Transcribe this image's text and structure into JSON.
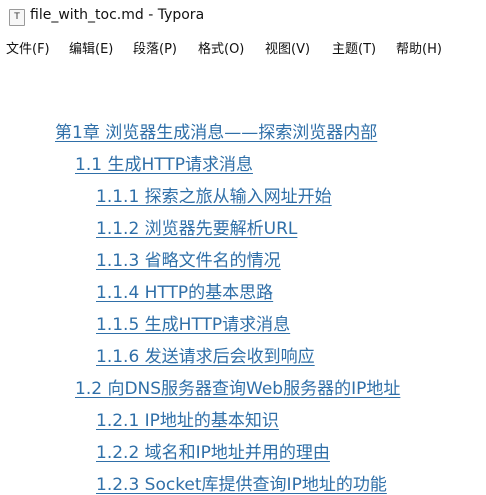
{
  "window": {
    "title": "file_with_toc.md - Typora",
    "icon": "typora-app-icon",
    "icon_glyph": "T"
  },
  "menubar": {
    "items": [
      {
        "label": "文件(F)"
      },
      {
        "label": "编辑(E)"
      },
      {
        "label": "段落(P)"
      },
      {
        "label": "格式(O)"
      },
      {
        "label": "视图(V)"
      },
      {
        "label": "主题(T)"
      },
      {
        "label": "帮助(H)"
      }
    ]
  },
  "toc": {
    "link_color": "#2f6fa8",
    "items": [
      {
        "label": "第1章 浏览器生成消息——探索浏览器内部",
        "level": 1
      },
      {
        "label": "1.1 生成HTTP请求消息",
        "level": 2
      },
      {
        "label": "1.1.1 探索之旅从输入网址开始",
        "level": 3
      },
      {
        "label": "1.1.2 浏览器先要解析URL",
        "level": 3
      },
      {
        "label": "1.1.3 省略文件名的情况",
        "level": 3
      },
      {
        "label": "1.1.4 HTTP的基本思路",
        "level": 3
      },
      {
        "label": "1.1.5 生成HTTP请求消息",
        "level": 3
      },
      {
        "label": "1.1.6 发送请求后会收到响应",
        "level": 3
      },
      {
        "label": "1.2 向DNS服务器查询Web服务器的IP地址",
        "level": 2
      },
      {
        "label": "1.2.1 IP地址的基本知识",
        "level": 3
      },
      {
        "label": "1.2.2 域名和IP地址并用的理由",
        "level": 3
      },
      {
        "label": "1.2.3 Socket库提供查询IP地址的功能",
        "level": 3
      }
    ]
  }
}
